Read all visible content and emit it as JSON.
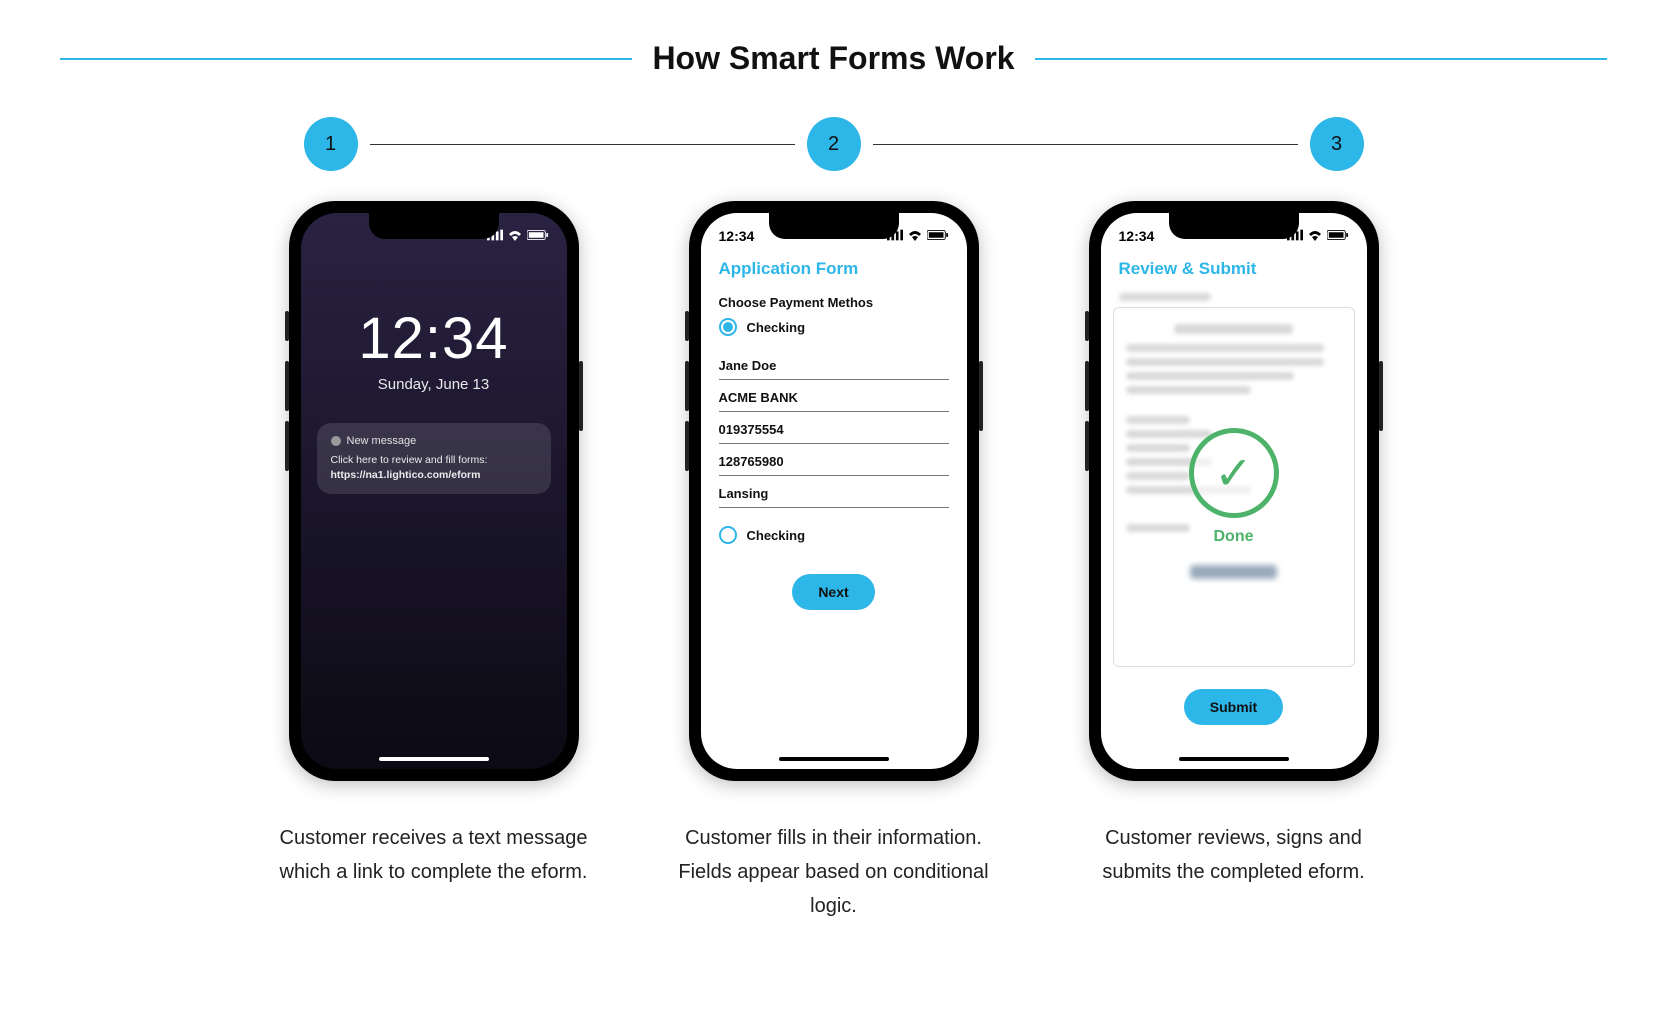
{
  "title": "How Smart Forms Work",
  "steps": {
    "one": "1",
    "two": "2",
    "three": "3"
  },
  "phone1": {
    "status_time": "",
    "lock_time": "12:34",
    "lock_date": "Sunday, June 13",
    "notif_title": "New message",
    "notif_line1": "Click here to review and fill forms:",
    "notif_link": "https://na1.lightico.com/eform"
  },
  "phone2": {
    "status_time": "12:34",
    "title": "Application Form",
    "choose_label": "Choose Payment Methos",
    "radio1": "Checking",
    "field_name": "Jane Doe",
    "field_bank": "ACME BANK",
    "field_num1": "019375554",
    "field_num2": "128765980",
    "field_city": "Lansing",
    "radio2": "Checking",
    "next_label": "Next"
  },
  "phone3": {
    "status_time": "12:34",
    "title": "Review & Submit",
    "done_label": "Done",
    "submit_label": "Submit"
  },
  "captions": {
    "c1": "Customer receives a text message which a link to complete the eform.",
    "c2": "Customer fills in their information. Fields appear based on conditional logic.",
    "c3": "Customer reviews, signs and submits the completed eform."
  }
}
